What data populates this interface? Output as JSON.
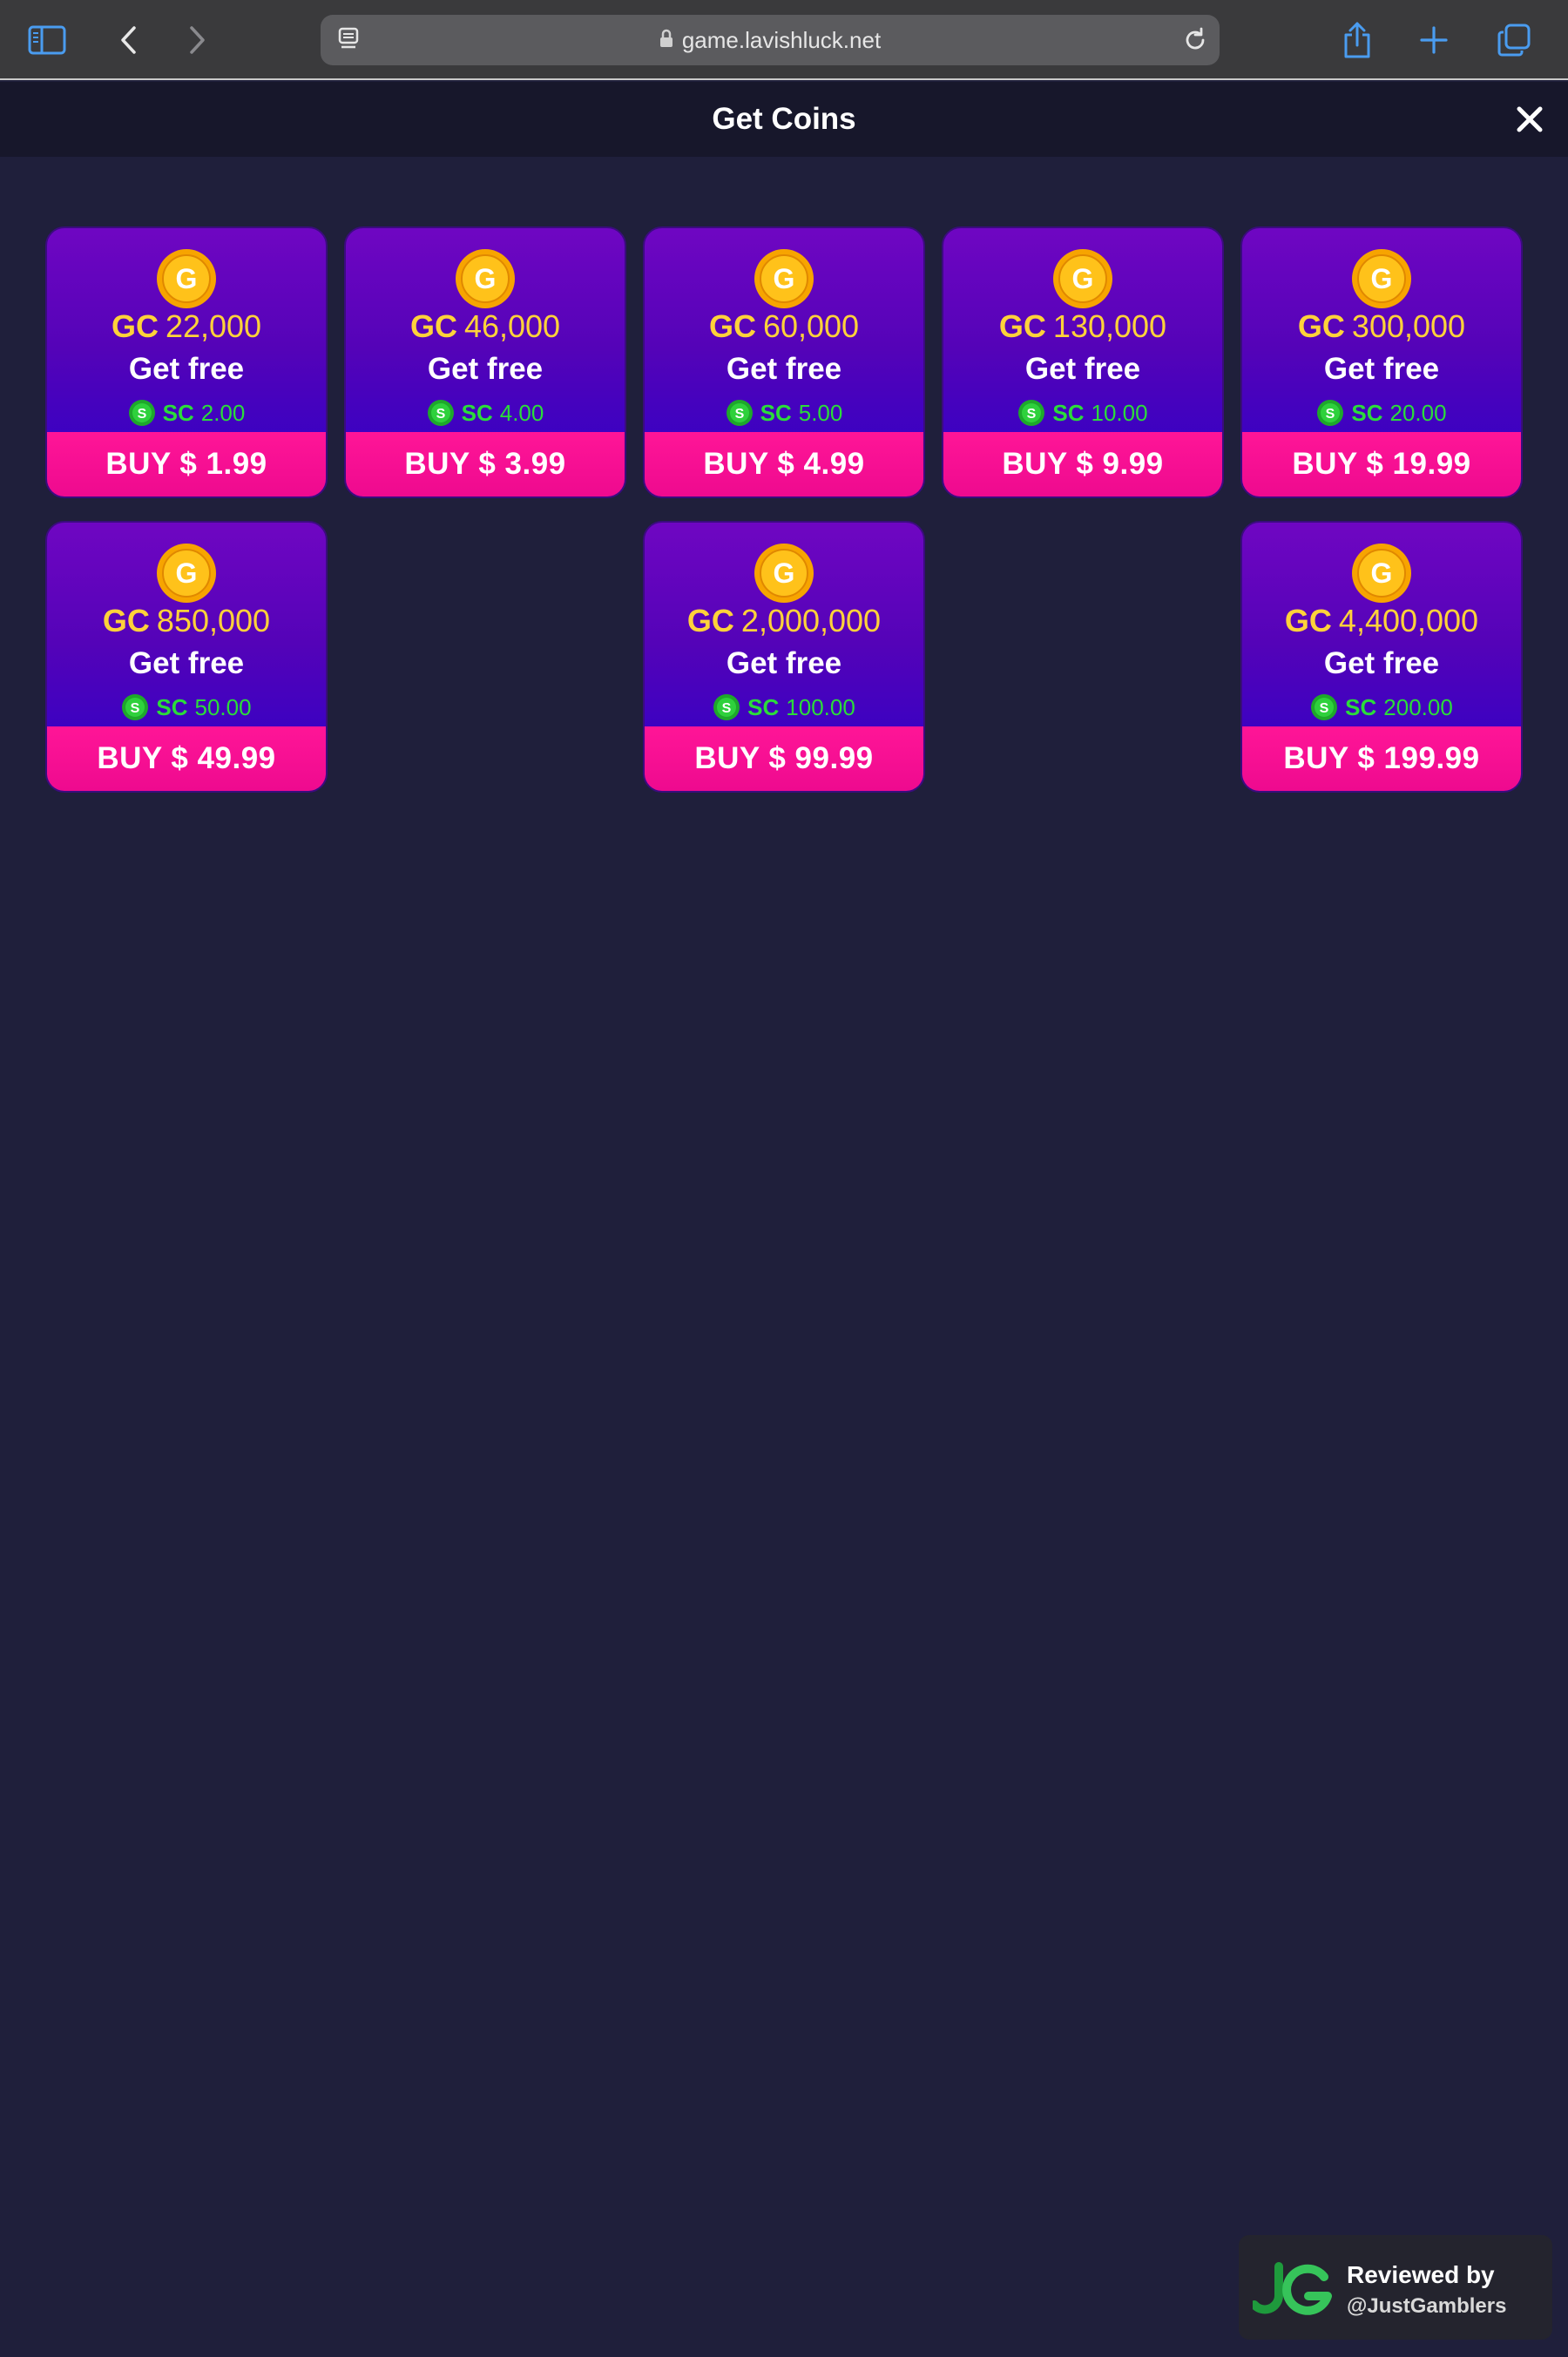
{
  "browser": {
    "url": "game.lavishluck.net",
    "icons": [
      "sidebar-icon",
      "back-icon",
      "forward-icon",
      "reader-icon",
      "lock-icon",
      "reload-icon",
      "share-icon",
      "new-tab-icon",
      "tabs-icon"
    ],
    "accent_color": "#4a9cf0"
  },
  "modal": {
    "title": "Get Coins",
    "close_icon": "close-icon"
  },
  "colors": {
    "background": "#1f1f3b",
    "card_gradient_top": "#6f06c2",
    "card_gradient_bottom": "#2c00c8",
    "buy_button": "#ff1597",
    "gc_text": "#ffd23a",
    "sc_text": "#2bdc3a"
  },
  "cards": [
    {
      "gc_label": "GC",
      "gc_amount": "22,000",
      "free_label": "Get free",
      "sc_label": "SC",
      "sc_amount": "2.00",
      "buy_label": "BUY $ 1.99"
    },
    {
      "gc_label": "GC",
      "gc_amount": "46,000",
      "free_label": "Get free",
      "sc_label": "SC",
      "sc_amount": "4.00",
      "buy_label": "BUY $ 3.99"
    },
    {
      "gc_label": "GC",
      "gc_amount": "60,000",
      "free_label": "Get free",
      "sc_label": "SC",
      "sc_amount": "5.00",
      "buy_label": "BUY $ 4.99"
    },
    {
      "gc_label": "GC",
      "gc_amount": "130,000",
      "free_label": "Get free",
      "sc_label": "SC",
      "sc_amount": "10.00",
      "buy_label": "BUY $ 9.99"
    },
    {
      "gc_label": "GC",
      "gc_amount": "300,000",
      "free_label": "Get free",
      "sc_label": "SC",
      "sc_amount": "20.00",
      "buy_label": "BUY $ 19.99"
    },
    {
      "gc_label": "GC",
      "gc_amount": "850,000",
      "free_label": "Get free",
      "sc_label": "SC",
      "sc_amount": "50.00",
      "buy_label": "BUY $ 49.99"
    },
    {
      "gc_label": "GC",
      "gc_amount": "2,000,000",
      "free_label": "Get free",
      "sc_label": "SC",
      "sc_amount": "100.00",
      "buy_label": "BUY $ 99.99"
    },
    {
      "gc_label": "GC",
      "gc_amount": "4,400,000",
      "free_label": "Get free",
      "sc_label": "SC",
      "sc_amount": "200.00",
      "buy_label": "BUY $ 199.99"
    }
  ],
  "badge": {
    "line1": "Reviewed by",
    "line2": "@JustGamblers",
    "logo_text": "JG"
  }
}
